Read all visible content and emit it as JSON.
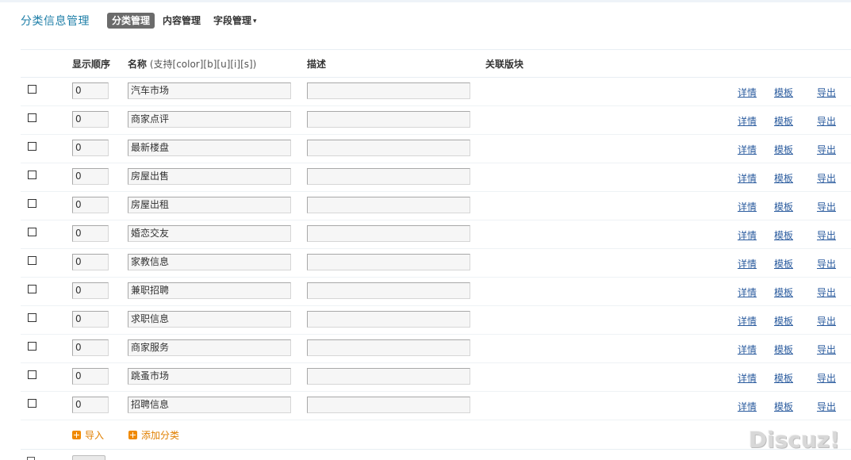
{
  "header": {
    "title": "分类信息管理",
    "tabs": [
      {
        "label": "分类管理",
        "active": true
      },
      {
        "label": "内容管理",
        "active": false
      },
      {
        "label": "字段管理",
        "active": false,
        "dropdown": true
      }
    ],
    "dropdown_glyph": "▾"
  },
  "table": {
    "columns": {
      "order": "显示顺序",
      "name": "名称",
      "name_hint": " (支持[color][b][u][i][s])",
      "desc": "描述",
      "block": "关联版块"
    },
    "rows": [
      {
        "order": "0",
        "name": "汽车市场",
        "desc": ""
      },
      {
        "order": "0",
        "name": "商家点评",
        "desc": ""
      },
      {
        "order": "0",
        "name": "最新楼盘",
        "desc": ""
      },
      {
        "order": "0",
        "name": "房屋出售",
        "desc": ""
      },
      {
        "order": "0",
        "name": "房屋出租",
        "desc": ""
      },
      {
        "order": "0",
        "name": "婚恋交友",
        "desc": ""
      },
      {
        "order": "0",
        "name": "家教信息",
        "desc": ""
      },
      {
        "order": "0",
        "name": "兼职招聘",
        "desc": ""
      },
      {
        "order": "0",
        "name": "求职信息",
        "desc": ""
      },
      {
        "order": "0",
        "name": "商家服务",
        "desc": ""
      },
      {
        "order": "0",
        "name": "跳蚤市场",
        "desc": ""
      },
      {
        "order": "0",
        "name": "招聘信息",
        "desc": ""
      }
    ],
    "row_links": {
      "detail": "详情",
      "template": "模板",
      "export": "导出"
    }
  },
  "footer": {
    "import_label": "导入",
    "add_label": "添加分类",
    "icon": "plus-square-icon",
    "accent": "#f08a00"
  },
  "watermark": "Discuz!",
  "colors": {
    "title": "#1f7fa8",
    "link": "#2a5b9e",
    "tab_active_bg": "#6b6b6b"
  }
}
